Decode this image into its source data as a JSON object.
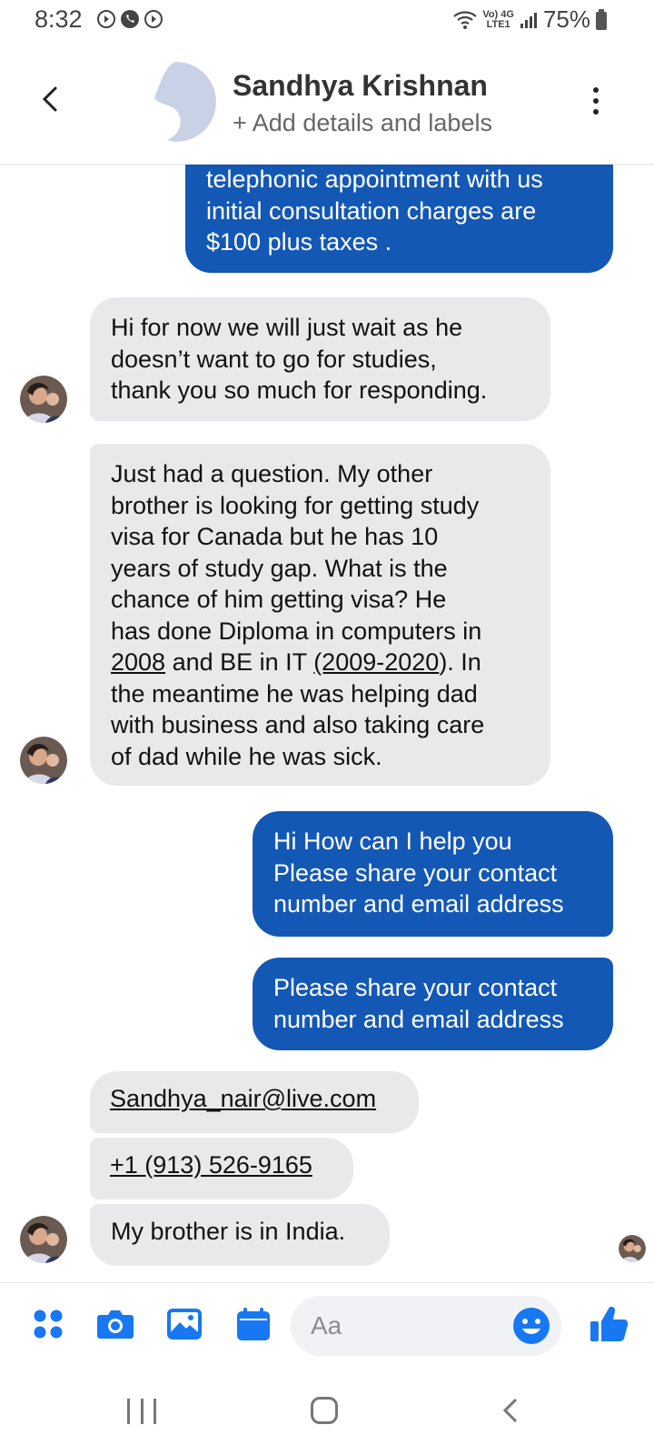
{
  "status_bar": {
    "time": "8:32",
    "network_line1": "Vo) 4G",
    "network_line2": "LTE1",
    "battery": "75%"
  },
  "header": {
    "contact_name": "Sandhya Krishnan",
    "subtitle": "+ Add details and labels",
    "icons": [
      "back-arrow-icon",
      "avatar-placeholder",
      "more-vertical-icon"
    ]
  },
  "messages": [
    {
      "id": "m1",
      "direction": "outgoing",
      "lines": [
        "telephonic appointment with us",
        "initial consultation charges are",
        "$100 plus taxes ."
      ]
    },
    {
      "id": "m2",
      "direction": "incoming",
      "lines": [
        "Hi for now we will just wait as he",
        "doesn’t want to go for studies,",
        "thank you so much for responding."
      ]
    },
    {
      "id": "m3",
      "direction": "incoming",
      "lines": [
        "Just had a question. My other",
        "brother is looking for getting study",
        "visa for Canada but he has 10",
        "years of study gap. What is the",
        "chance of him getting visa? He",
        "has done Diploma in computers in"
      ],
      "line7": {
        "link1": "2008",
        "middle": " and BE in IT ",
        "link2": "(2009-2020",
        "end": "). In"
      },
      "lines_end": [
        "the meantime he was helping dad",
        "with business and also taking care",
        "of dad while he was sick."
      ]
    },
    {
      "id": "m4",
      "direction": "outgoing",
      "lines": [
        "Hi How can I help you",
        "Please share your contact",
        "number and email address"
      ]
    },
    {
      "id": "m5",
      "direction": "outgoing",
      "lines": [
        "Please share your contact",
        "number and email address"
      ]
    },
    {
      "id": "m6",
      "direction": "incoming",
      "text": "Sandhya_nair@live.com"
    },
    {
      "id": "m7",
      "direction": "incoming",
      "text": "+1 (913) 526-9165"
    },
    {
      "id": "m8",
      "direction": "incoming",
      "text": "My brother is in India."
    }
  ],
  "composer": {
    "placeholder": "Aa",
    "icons": [
      "menu-grid-icon",
      "camera-icon",
      "gallery-icon",
      "calendar-icon",
      "emoji-icon",
      "thumbs-up-icon"
    ]
  },
  "colors": {
    "outgoing_bubble": "#1458b5",
    "incoming_bubble": "#e9e9eb",
    "accent": "#1877f2"
  },
  "nav": {
    "icons": [
      "recents-icon",
      "home-icon",
      "back-icon"
    ]
  }
}
